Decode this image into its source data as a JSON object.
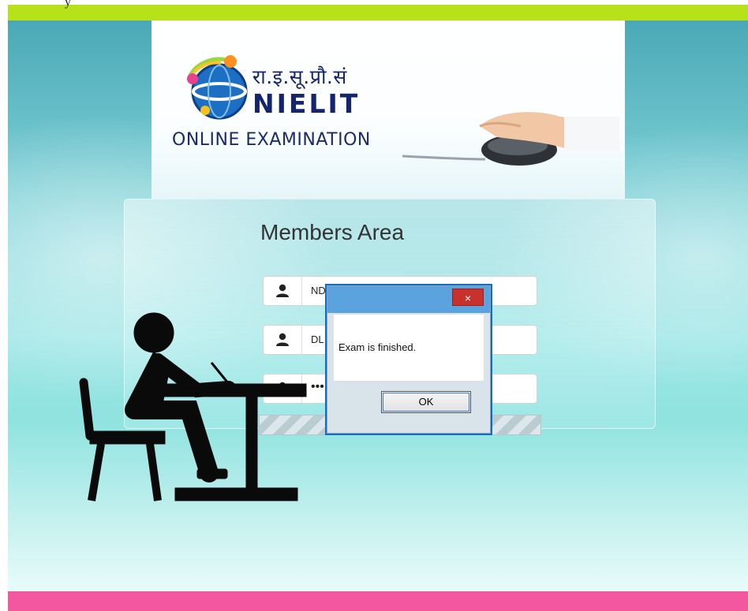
{
  "top_caption": "y",
  "logo": {
    "hindi": "रा.इ.सू.प्रौ.सं",
    "brand": "NIELIT",
    "subtitle": "ONLINE EXAMINATION"
  },
  "login": {
    "title": "Members Area",
    "fields": [
      {
        "icon": "user-icon",
        "visible_text": "ND"
      },
      {
        "icon": "user-icon",
        "visible_text": "DL"
      },
      {
        "icon": "user-icon",
        "visible_text": "•••"
      }
    ]
  },
  "dialog": {
    "close_label": "×",
    "message": "Exam is finished.",
    "ok_label": "OK"
  },
  "colors": {
    "top_bar": "#b7e21a",
    "bottom_bar": "#f2579f",
    "dialog_title": "#5aa3de",
    "close_button": "#c9312d",
    "brand_navy": "#14256e"
  }
}
